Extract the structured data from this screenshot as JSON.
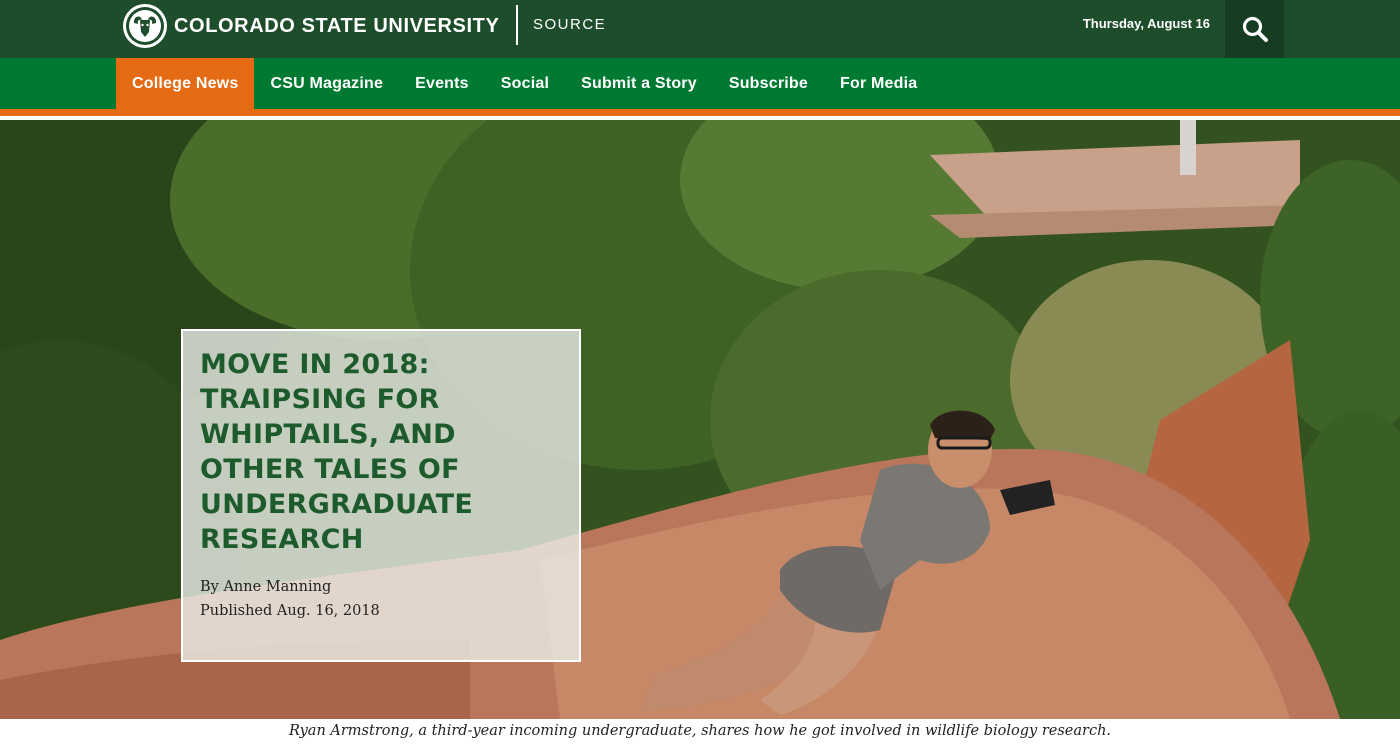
{
  "header": {
    "university_name": "COLORADO STATE UNIVERSITY",
    "section_name": "SOURCE",
    "date": "Thursday, August 16",
    "logo_icon": "ram-head-logo",
    "search_icon": "search-icon"
  },
  "nav": {
    "items": [
      {
        "label": "College News",
        "active": true
      },
      {
        "label": "CSU Magazine",
        "active": false
      },
      {
        "label": "Events",
        "active": false
      },
      {
        "label": "Social",
        "active": false
      },
      {
        "label": "Submit a Story",
        "active": false
      },
      {
        "label": "Subscribe",
        "active": false
      },
      {
        "label": "For Media",
        "active": false
      }
    ]
  },
  "article": {
    "title": "Move in 2018: Traipsing for whiptails, and other tales of undergraduate research",
    "byline": "By Anne Manning",
    "published": "Published Aug. 16, 2018",
    "caption": "Ryan Armstrong, a third-year incoming undergraduate, shares how he got involved in wildlife biology research."
  },
  "colors": {
    "csu_green": "#1e4d2b",
    "nav_green": "#007a33",
    "accent_orange": "#e56a14",
    "headline_green": "#1e5b2c"
  }
}
